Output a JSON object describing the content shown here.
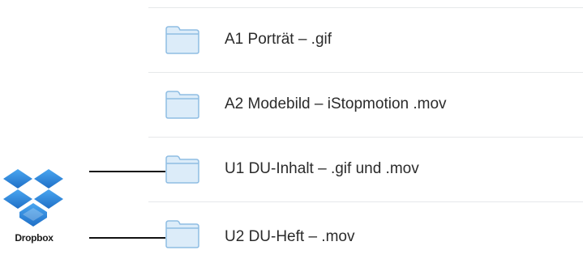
{
  "folders": [
    {
      "name": "A1 Porträt – .gif",
      "icon": "folder-icon"
    },
    {
      "name": "A2 Modebild – iStopmotion .mov",
      "icon": "folder-icon"
    },
    {
      "name": "U1 DU-Inhalt – .gif und .mov",
      "icon": "folder-icon"
    },
    {
      "name": "U2 DU-Heft – .mov",
      "icon": "folder-icon"
    }
  ],
  "logo": {
    "text": "Dropbox",
    "icon": "dropbox-logo-icon",
    "color": "#2e8ee6"
  },
  "colors": {
    "folder_fill": "#dcecf9",
    "folder_stroke": "#8fbde3",
    "divider": "#e6e8ea",
    "connector": "#111111"
  }
}
